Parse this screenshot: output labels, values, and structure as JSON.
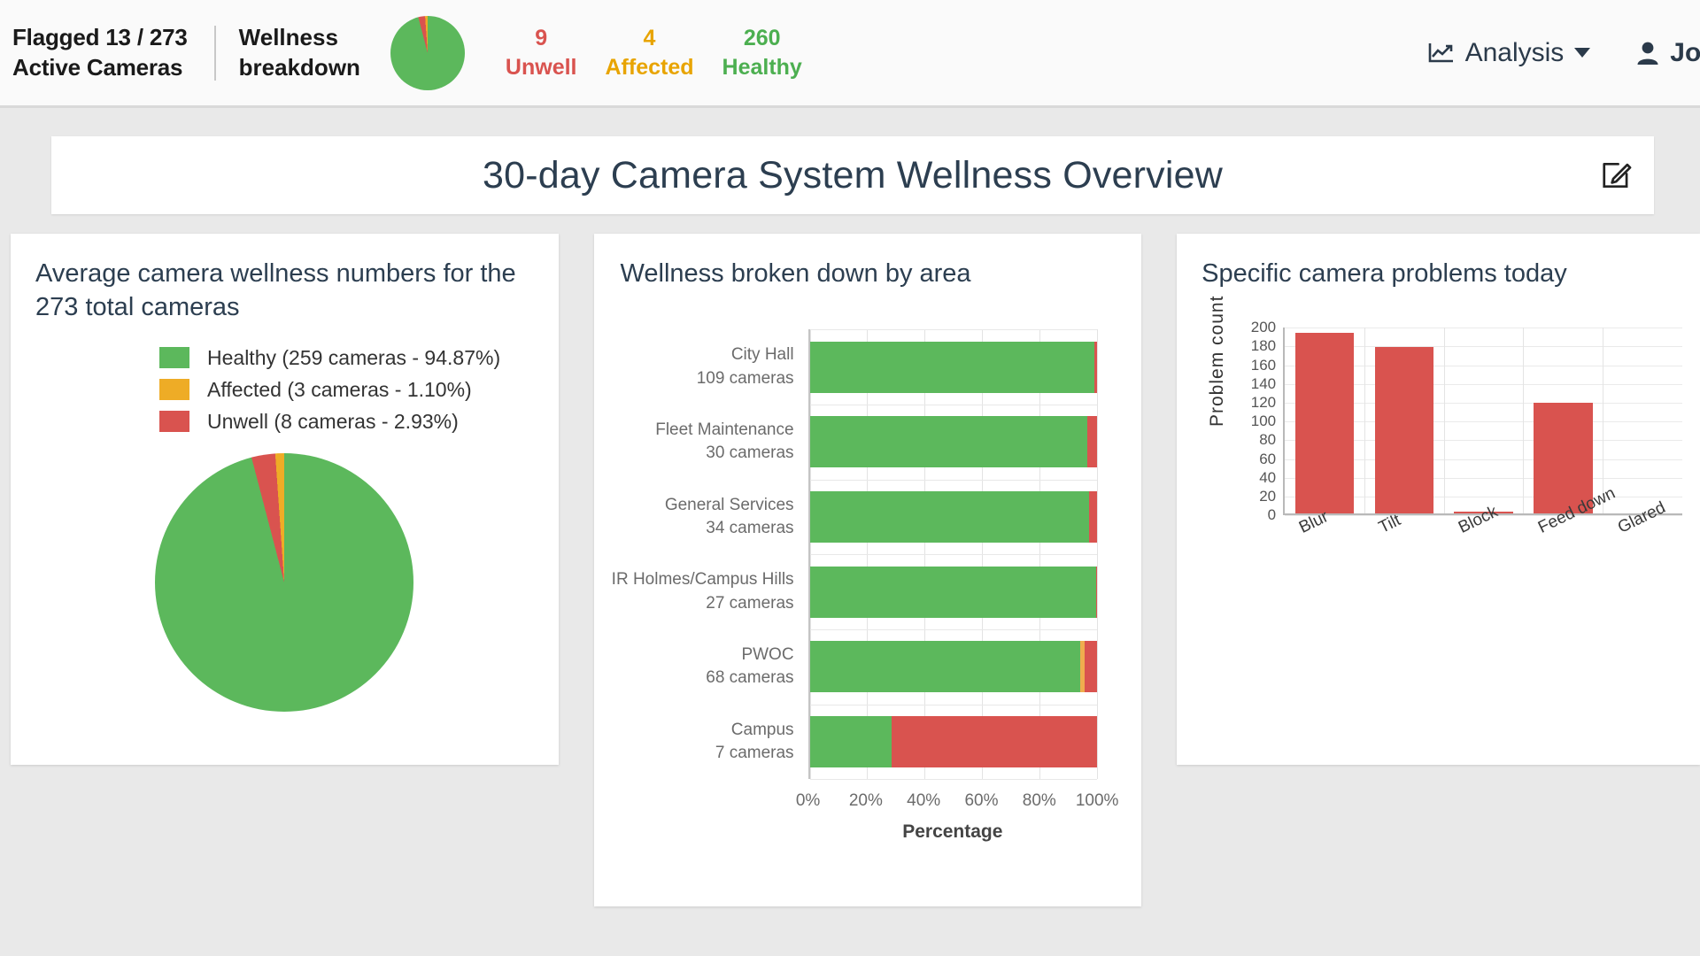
{
  "topbar": {
    "flagged_line1": "Flagged 13 / 273",
    "flagged_line2": "Active Cameras",
    "wellness_line1": "Wellness",
    "wellness_line2": "breakdown",
    "mini_pie_icon": "pie-chart-icon",
    "stats": [
      {
        "value": "9",
        "label": "Unwell",
        "color": "#d9534f"
      },
      {
        "value": "4",
        "label": "Affected",
        "color": "#e8a400"
      },
      {
        "value": "260",
        "label": "Healthy",
        "color": "#4caf50"
      }
    ],
    "nav": {
      "analysis_label": "Analysis",
      "analysis_icon": "line-chart-icon",
      "user_label": "Joe",
      "user_icon": "person-icon",
      "caret_icon": "chevron-down-icon"
    }
  },
  "header": {
    "title": "30-day Camera System Wellness Overview",
    "edit_icon": "edit-pencil-icon"
  },
  "cards": {
    "pie": {
      "title": "Average camera wellness numbers for the 273 total cameras",
      "legend": [
        {
          "label": "Healthy (259 cameras - 94.87%)",
          "color": "#5cb85c"
        },
        {
          "label": "Affected (3 cameras - 1.10%)",
          "color": "#eeac26"
        },
        {
          "label": "Unwell (8 cameras - 2.93%)",
          "color": "#d9534f"
        }
      ]
    },
    "area": {
      "title": "Wellness broken down by area"
    },
    "problems": {
      "title": "Specific camera problems today"
    }
  },
  "chart_data": [
    {
      "type": "pie",
      "title": "Average camera wellness numbers for the 273 total cameras",
      "total_cameras": 273,
      "labels": [
        "Healthy",
        "Affected",
        "Unwell"
      ],
      "values": [
        259,
        3,
        8
      ],
      "percentages": [
        94.87,
        1.1,
        2.93
      ],
      "colors": [
        "#5cb85c",
        "#eeac26",
        "#d9534f"
      ],
      "legend_position": "top"
    },
    {
      "type": "bar",
      "orientation": "horizontal",
      "stacked": true,
      "title": "Wellness broken down by area",
      "xlabel": "Percentage",
      "ylabel": "",
      "xlim": [
        0,
        100
      ],
      "xticks": [
        "0%",
        "20%",
        "40%",
        "60%",
        "80%",
        "100%"
      ],
      "grid": true,
      "categories": [
        {
          "name": "City Hall",
          "sub": "109 cameras"
        },
        {
          "name": "Fleet Maintenance",
          "sub": "30 cameras"
        },
        {
          "name": "General Services",
          "sub": "34 cameras"
        },
        {
          "name": "IR Holmes/Campus Hills",
          "sub": "27 cameras"
        },
        {
          "name": "PWOC",
          "sub": "68 cameras"
        },
        {
          "name": "Campus",
          "sub": "7 cameras"
        }
      ],
      "series": [
        {
          "name": "Healthy",
          "color": "#5cb85c",
          "values": [
            99.1,
            96.7,
            97.1,
            99.6,
            94.1,
            28.6
          ]
        },
        {
          "name": "Affected",
          "color": "#f0ad4e",
          "values": [
            0.0,
            0.0,
            0.0,
            0.0,
            1.5,
            0.0
          ]
        },
        {
          "name": "Unwell",
          "color": "#d9534f",
          "values": [
            0.9,
            3.3,
            2.9,
            0.4,
            4.4,
            71.4
          ]
        }
      ]
    },
    {
      "type": "bar",
      "orientation": "vertical",
      "title": "Specific camera problems today",
      "xlabel": "",
      "ylabel": "Problem count",
      "ylim": [
        0,
        200
      ],
      "yticks": [
        0,
        20,
        40,
        60,
        80,
        100,
        120,
        140,
        160,
        180,
        200
      ],
      "grid": true,
      "categories": [
        "Blur",
        "Tilt",
        "Block",
        "Feed down",
        "Glared"
      ],
      "values": [
        193,
        178,
        1,
        118,
        0
      ],
      "color": "#d9534f"
    }
  ]
}
